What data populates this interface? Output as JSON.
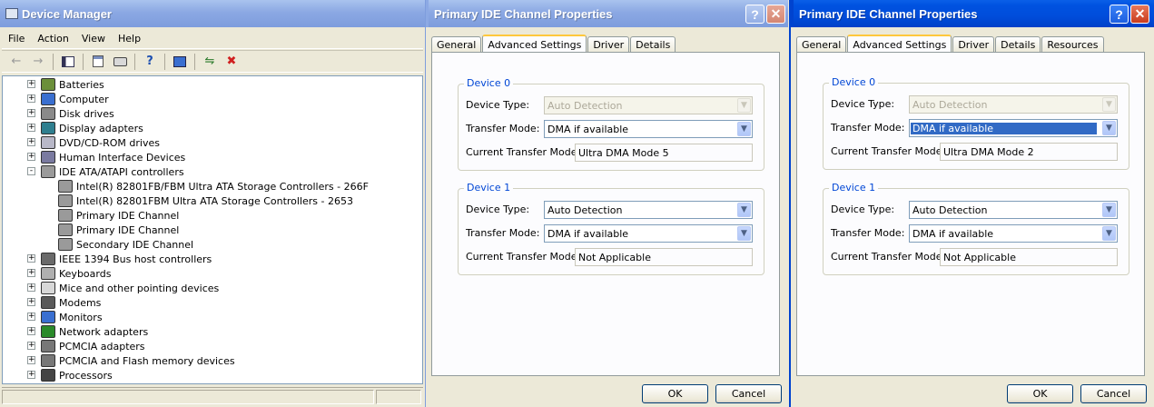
{
  "device_manager": {
    "title": "Device Manager",
    "menu": [
      "File",
      "Action",
      "View",
      "Help"
    ],
    "toolbar_icons": [
      "back-arrow-icon",
      "forward-arrow-icon",
      "show-hide-tree-icon",
      "properties-icon",
      "print-icon",
      "help-icon",
      "computer-icon",
      "scan-hardware-icon",
      "uninstall-icon"
    ],
    "tree": [
      {
        "label": "Batteries",
        "level": 0,
        "expander": "+",
        "icon": "battery"
      },
      {
        "label": "Computer",
        "level": 0,
        "expander": "+",
        "icon": "computer"
      },
      {
        "label": "Disk drives",
        "level": 0,
        "expander": "+",
        "icon": "disk"
      },
      {
        "label": "Display adapters",
        "level": 0,
        "expander": "+",
        "icon": "display"
      },
      {
        "label": "DVD/CD-ROM drives",
        "level": 0,
        "expander": "+",
        "icon": "dvd"
      },
      {
        "label": "Human Interface Devices",
        "level": 0,
        "expander": "+",
        "icon": "hid"
      },
      {
        "label": "IDE ATA/ATAPI controllers",
        "level": 0,
        "expander": "-",
        "icon": "ide"
      },
      {
        "label": "Intel(R) 82801FB/FBM Ultra ATA Storage Controllers - 266F",
        "level": 1,
        "icon": "ide"
      },
      {
        "label": "Intel(R) 82801FBM Ultra ATA Storage Controllers - 2653",
        "level": 1,
        "icon": "ide"
      },
      {
        "label": "Primary IDE Channel",
        "level": 1,
        "icon": "ide"
      },
      {
        "label": "Primary IDE Channel",
        "level": 1,
        "icon": "ide"
      },
      {
        "label": "Secondary IDE Channel",
        "level": 1,
        "icon": "ide"
      },
      {
        "label": "IEEE 1394 Bus host controllers",
        "level": 0,
        "expander": "+",
        "icon": "ieee"
      },
      {
        "label": "Keyboards",
        "level": 0,
        "expander": "+",
        "icon": "keyboard"
      },
      {
        "label": "Mice and other pointing devices",
        "level": 0,
        "expander": "+",
        "icon": "mouse"
      },
      {
        "label": "Modems",
        "level": 0,
        "expander": "+",
        "icon": "modem"
      },
      {
        "label": "Monitors",
        "level": 0,
        "expander": "+",
        "icon": "monitor"
      },
      {
        "label": "Network adapters",
        "level": 0,
        "expander": "+",
        "icon": "network"
      },
      {
        "label": "PCMCIA adapters",
        "level": 0,
        "expander": "+",
        "icon": "pcmcia"
      },
      {
        "label": "PCMCIA and Flash memory devices",
        "level": 0,
        "expander": "+",
        "icon": "pcmcia"
      },
      {
        "label": "Processors",
        "level": 0,
        "expander": "+",
        "icon": "processor"
      }
    ]
  },
  "dialog1": {
    "title": "Primary IDE Channel Properties",
    "tabs": [
      "General",
      "Advanced Settings",
      "Driver",
      "Details"
    ],
    "selected_tab": "Advanced Settings",
    "device0": {
      "legend": "Device 0",
      "device_type_label": "Device Type:",
      "device_type_value": "Auto Detection",
      "transfer_mode_label": "Transfer Mode:",
      "transfer_mode_value": "DMA if available",
      "current_label": "Current Transfer Mode:",
      "current_value": "Ultra DMA Mode 5"
    },
    "device1": {
      "legend": "Device 1",
      "device_type_label": "Device Type:",
      "device_type_value": "Auto Detection",
      "transfer_mode_label": "Transfer Mode:",
      "transfer_mode_value": "DMA if available",
      "current_label": "Current Transfer Mode:",
      "current_value": "Not Applicable"
    },
    "ok_label": "OK",
    "cancel_label": "Cancel"
  },
  "dialog2": {
    "title": "Primary IDE Channel Properties",
    "tabs": [
      "General",
      "Advanced Settings",
      "Driver",
      "Details",
      "Resources"
    ],
    "selected_tab": "Advanced Settings",
    "device0": {
      "legend": "Device 0",
      "device_type_label": "Device Type:",
      "device_type_value": "Auto Detection",
      "transfer_mode_label": "Transfer Mode:",
      "transfer_mode_value": "DMA if available",
      "current_label": "Current Transfer Mode:",
      "current_value": "Ultra DMA Mode 2"
    },
    "device1": {
      "legend": "Device 1",
      "device_type_label": "Device Type:",
      "device_type_value": "Auto Detection",
      "transfer_mode_label": "Transfer Mode:",
      "transfer_mode_value": "DMA if available",
      "current_label": "Current Transfer Mode:",
      "current_value": "Not Applicable"
    },
    "ok_label": "OK",
    "cancel_label": "Cancel"
  },
  "colors": {
    "active_title": "#0054e3",
    "inactive_title": "#8ba8e3",
    "group_legend": "#0046d5",
    "selection": "#316ac5"
  }
}
